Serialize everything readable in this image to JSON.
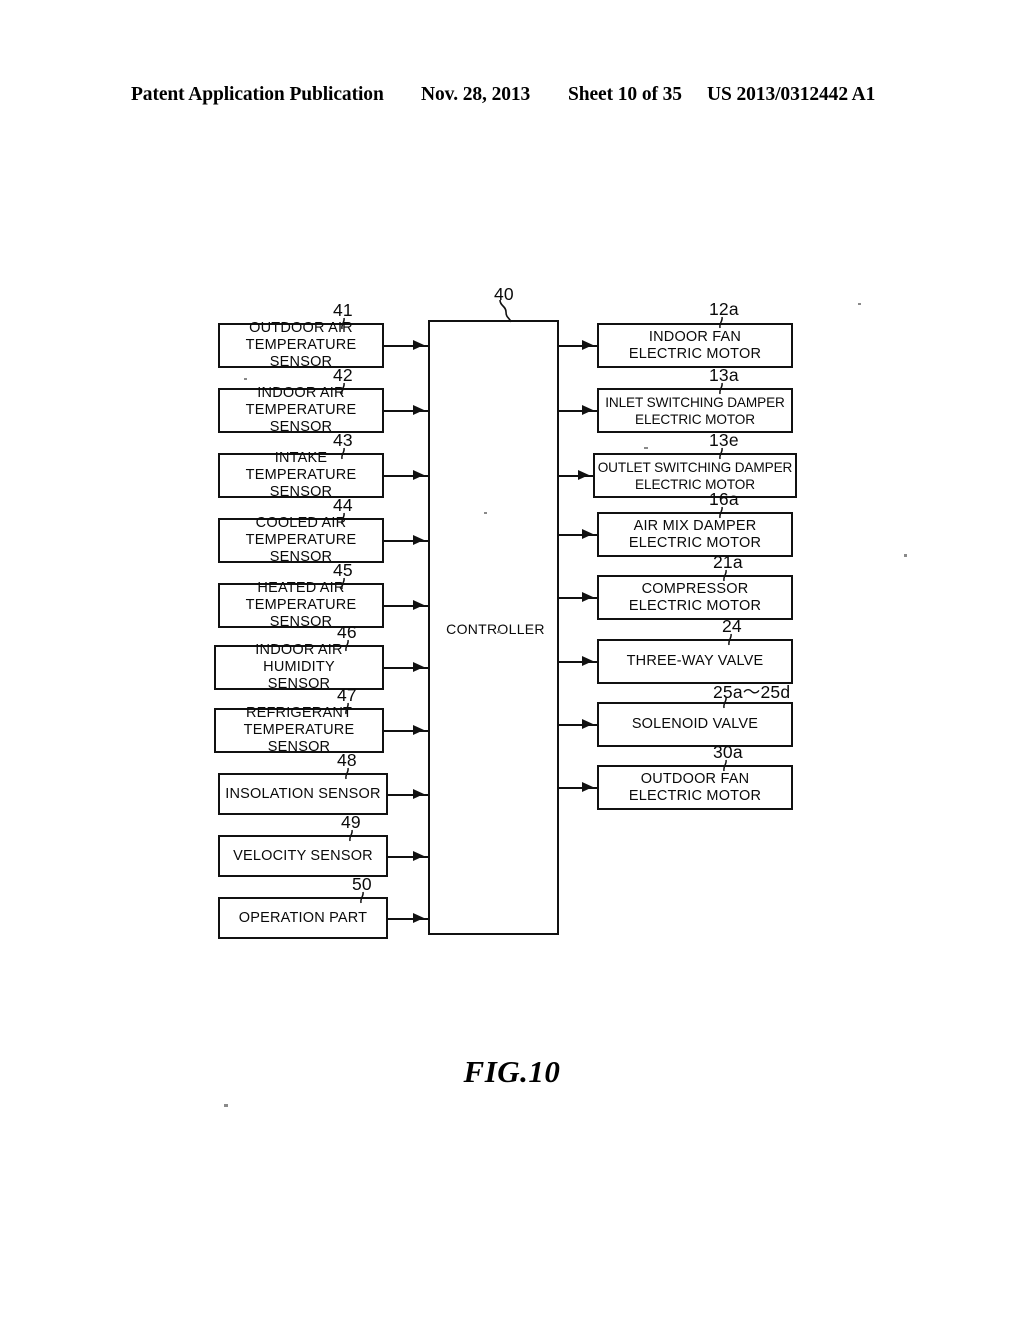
{
  "header": {
    "publication": "Patent Application Publication",
    "date": "Nov. 28, 2013",
    "sheet": "Sheet 10 of 35",
    "patent_number": "US 2013/0312442 A1"
  },
  "figure": {
    "caption": "FIG.10",
    "controller": {
      "label": "CONTROLLER",
      "ref": "40"
    },
    "inputs": [
      {
        "ref": "41",
        "label": "OUTDOOR AIR\nTEMPERATURE SENSOR"
      },
      {
        "ref": "42",
        "label": "INDOOR AIR\nTEMPERATURE SENSOR"
      },
      {
        "ref": "43",
        "label": "INTAKE\nTEMPERATURE SENSOR"
      },
      {
        "ref": "44",
        "label": "COOLED AIR\nTEMPERATURE SENSOR"
      },
      {
        "ref": "45",
        "label": "HEATED AIR\nTEMPERATURE SENSOR"
      },
      {
        "ref": "46",
        "label": "INDOOR AIR HUMIDITY\nSENSOR"
      },
      {
        "ref": "47",
        "label": "REFRIGERANT\nTEMPERATURE SENSOR"
      },
      {
        "ref": "48",
        "label": "INSOLATION SENSOR"
      },
      {
        "ref": "49",
        "label": "VELOCITY SENSOR"
      },
      {
        "ref": "50",
        "label": "OPERATION PART"
      }
    ],
    "outputs": [
      {
        "ref": "12a",
        "label": "INDOOR FAN\nELECTRIC MOTOR"
      },
      {
        "ref": "13a",
        "label": "INLET SWITCHING DAMPER\nELECTRIC MOTOR"
      },
      {
        "ref": "13e",
        "label": "OUTLET SWITCHING DAMPER\nELECTRIC MOTOR"
      },
      {
        "ref": "16a",
        "label": "AIR MIX DAMPER\nELECTRIC MOTOR"
      },
      {
        "ref": "21a",
        "label": "COMPRESSOR\nELECTRIC MOTOR"
      },
      {
        "ref": "24",
        "label": "THREE-WAY VALVE"
      },
      {
        "ref": "25a～25d",
        "label": "SOLENOID VALVE"
      },
      {
        "ref": "30a",
        "label": "OUTDOOR FAN\nELECTRIC MOTOR"
      }
    ]
  }
}
